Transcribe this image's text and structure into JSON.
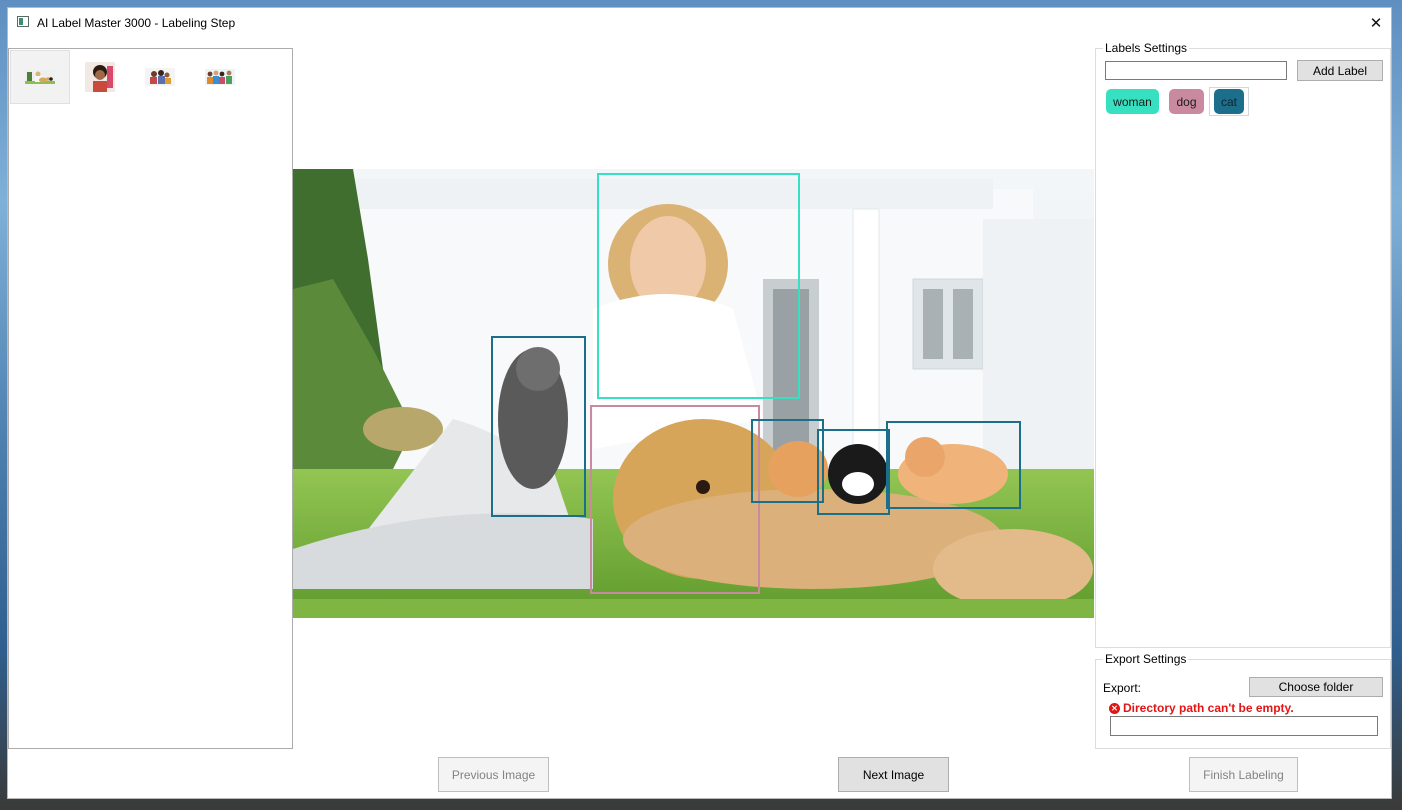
{
  "window": {
    "title": "AI Label Master 3000 - Labeling Step",
    "close_glyph": "✕"
  },
  "thumbnails": [
    {
      "name": "thumb-woman-dog-cats",
      "selected": true
    },
    {
      "name": "thumb-person-portrait",
      "selected": false
    },
    {
      "name": "thumb-family-group",
      "selected": false
    },
    {
      "name": "thumb-group-people",
      "selected": false
    }
  ],
  "labels_settings": {
    "title": "Labels Settings",
    "new_label_value": "",
    "add_label_button": "Add Label",
    "labels": [
      {
        "text": "woman",
        "color": "#36e0c0",
        "selected": false
      },
      {
        "text": "dog",
        "color": "#c98aa0",
        "selected": false
      },
      {
        "text": "cat",
        "color": "#1c6f8b",
        "selected": true
      }
    ]
  },
  "annotations": [
    {
      "label": "woman",
      "color": "#36e0c0"
    },
    {
      "label": "cat",
      "color": "#1c6f8b"
    },
    {
      "label": "dog",
      "color": "#c98aa0"
    },
    {
      "label": "cat",
      "color": "#1c6f8b"
    },
    {
      "label": "cat",
      "color": "#1c6f8b"
    },
    {
      "label": "cat",
      "color": "#1c6f8b"
    }
  ],
  "export_settings": {
    "title": "Export Settings",
    "export_label": "Export:",
    "choose_folder_button": "Choose folder",
    "error_message": "Directory path can't be empty.",
    "directory_value": ""
  },
  "footer": {
    "previous_button": "Previous Image",
    "next_button": "Next Image",
    "finish_button": "Finish Labeling"
  }
}
